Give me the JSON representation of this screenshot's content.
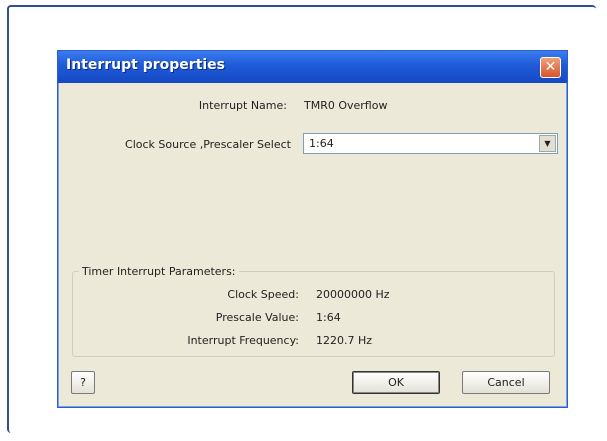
{
  "dialog": {
    "title": "Interrupt properties",
    "close_symbol": "✕"
  },
  "fields": {
    "interrupt_name_label": "Interrupt Name:",
    "interrupt_name_value": "TMR0 Overflow",
    "clock_source_label": "Clock Source ,Prescaler Select",
    "clock_source_value": "1:64"
  },
  "timer_group": {
    "legend": "Timer Interrupt Parameters:",
    "clock_speed_label": "Clock Speed:",
    "clock_speed_value": "20000000 Hz",
    "prescale_label": "Prescale Value:",
    "prescale_value": "1:64",
    "frequency_label": "Interrupt Frequency:",
    "frequency_value": "1220.7 Hz"
  },
  "buttons": {
    "help": "?",
    "ok": "OK",
    "cancel": "Cancel"
  },
  "icons": {
    "close": "close-icon",
    "dropdown": "chevron-down-icon"
  }
}
